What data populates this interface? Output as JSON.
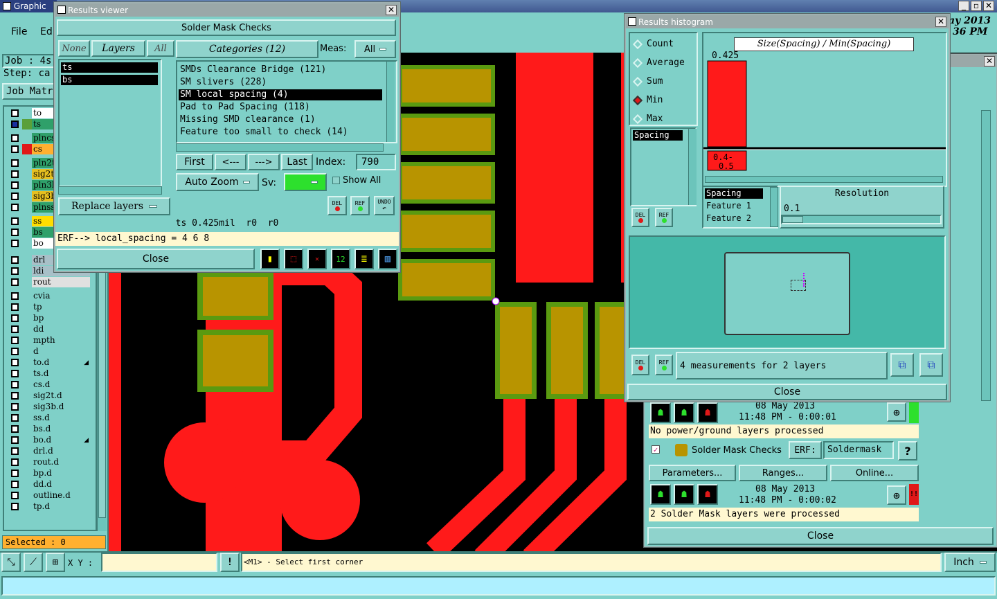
{
  "main_window": {
    "title": "Graphic Ed",
    "menu": [
      "File",
      "Edi"
    ],
    "job_label": "Job : 4s",
    "step_label": "Step: ca",
    "job_matrix_button": "Job Matr",
    "date_fragment": "ay 2013",
    "time_fragment": "36 PM"
  },
  "layers": [
    {
      "name": "to",
      "color": "#ffffff"
    },
    {
      "name": "ts",
      "color": "#2fa06a",
      "swatch": "#5aa03a",
      "active": true
    },
    {
      "name": "plncs",
      "color": "#2fa06a"
    },
    {
      "name": "cs",
      "color": "#ffb030",
      "swatch": "#e01818"
    },
    {
      "name": "pln2t",
      "color": "#2fa06a"
    },
    {
      "name": "sig2t",
      "color": "#e6c020"
    },
    {
      "name": "pln3b",
      "color": "#2fa06a"
    },
    {
      "name": "sig3b",
      "color": "#e6c020"
    },
    {
      "name": "plnss",
      "color": "#2fa06a"
    },
    {
      "name": "ss",
      "color": "#ffdd00"
    },
    {
      "name": "bs",
      "color": "#2fa06a"
    },
    {
      "name": "bo",
      "color": "#ffffff"
    },
    {
      "name": "drl",
      "color": "#a8c0c8"
    },
    {
      "name": "ldi",
      "color": "#a8c0c8"
    },
    {
      "name": "rout",
      "color": "#e0e0e0"
    },
    {
      "name": "cvia",
      "color": "#7fd0c8"
    },
    {
      "name": "tp",
      "color": "#7fd0c8"
    },
    {
      "name": "bp",
      "color": "#7fd0c8"
    },
    {
      "name": "dd",
      "color": "#7fd0c8"
    },
    {
      "name": "mpth",
      "color": "#7fd0c8"
    },
    {
      "name": "d",
      "color": "#7fd0c8"
    },
    {
      "name": "to.d",
      "color": "#7fd0c8",
      "flag": true
    },
    {
      "name": "ts.d",
      "color": "#7fd0c8"
    },
    {
      "name": "cs.d",
      "color": "#7fd0c8"
    },
    {
      "name": "sig2t.d",
      "color": "#7fd0c8"
    },
    {
      "name": "sig3b.d",
      "color": "#7fd0c8"
    },
    {
      "name": "ss.d",
      "color": "#7fd0c8"
    },
    {
      "name": "bs.d",
      "color": "#7fd0c8"
    },
    {
      "name": "bo.d",
      "color": "#7fd0c8",
      "flag": true
    },
    {
      "name": "drl.d",
      "color": "#7fd0c8"
    },
    {
      "name": "rout.d",
      "color": "#7fd0c8"
    },
    {
      "name": "bp.d",
      "color": "#7fd0c8"
    },
    {
      "name": "dd.d",
      "color": "#7fd0c8"
    },
    {
      "name": "outline.d",
      "color": "#7fd0c8"
    },
    {
      "name": "tp.d",
      "color": "#7fd0c8"
    }
  ],
  "selected_label": "Selected : 0",
  "bottom_bar": {
    "xy_label": "X Y :",
    "xy_value": "",
    "hint": "<M1> - Select first corner",
    "units": "Inch"
  },
  "results_viewer": {
    "title": "Results viewer",
    "header": "Solder Mask Checks",
    "none_btn": "None",
    "layers_btn": "Layers",
    "all_btn": "All",
    "layer_items": [
      "ts",
      "bs"
    ],
    "categories_btn": "Categories (12)",
    "meas_label": "Meas:",
    "meas_value": "All",
    "categories": [
      {
        "label": "SMDs Clearance Bridge (121)",
        "selected": false
      },
      {
        "label": "SM slivers (228)",
        "selected": false
      },
      {
        "label": "SM local spacing (4)",
        "selected": true
      },
      {
        "label": "Pad to Pad Spacing (118)",
        "selected": false
      },
      {
        "label": "Missing SMD clearance (1)",
        "selected": false
      },
      {
        "label": "Feature too small to check (14)",
        "selected": false
      }
    ],
    "first_btn": "First",
    "prev_btn": "<---",
    "next_btn": "--->",
    "last_btn": "Last",
    "index_label": "Index:",
    "index_value": "790",
    "auto_zoom": "Auto Zoom",
    "sv_label": "Sv:",
    "show_all": "Show All",
    "replace_layers": "Replace layers",
    "del_btn": "DEL",
    "ref_btn": "REF",
    "undo_btn": "UNDO",
    "status_line": "ts 0.425mil  r0  r0",
    "erf_line": "ERF--> local_spacing = 4 6 8",
    "close_btn": "Close"
  },
  "histogram": {
    "title": "Results histogram",
    "options": [
      {
        "label": "Count",
        "selected": false
      },
      {
        "label": "Average",
        "selected": false
      },
      {
        "label": "Sum",
        "selected": false
      },
      {
        "label": "Min",
        "selected": true
      },
      {
        "label": "Max",
        "selected": false
      }
    ],
    "spacing_list_item": "Spacing",
    "chart_title": "Size(Spacing) / Min(Spacing)",
    "bar_value_label": "0.425",
    "bin_label": "0.4-\n0.5",
    "list2": [
      "Spacing",
      "Feature 1",
      "Feature 2"
    ],
    "resolution_label": "Resolution",
    "resolution_value": "0.1",
    "measurements": "4 measurements for 2 layers",
    "close_btn": "Close",
    "del_btn": "DEL",
    "ref_btn": "REF"
  },
  "analysis_panel": {
    "date1": "08 May 2013",
    "time1": "11:48 PM - 0:00:01",
    "msg1": "No power/ground layers processed",
    "action_title": "Solder Mask Checks",
    "erf_label": "ERF:",
    "erf_value": "Soldermask",
    "help_btn": "?",
    "params_btn": "Parameters...",
    "ranges_btn": "Ranges...",
    "online_btn": "Online...",
    "date2": "08 May 2013",
    "time2": "11:48 PM - 0:00:02",
    "msg2": "2 Solder Mask layers were processed",
    "close_btn": "Close",
    "alert": "!!"
  },
  "chart_data": {
    "type": "bar",
    "title": "Size(Spacing) / Min(Spacing)",
    "categories": [
      "0.4-0.5"
    ],
    "values": [
      0.425
    ],
    "xlabel": "",
    "ylabel": ""
  },
  "colors": {
    "panel": "#7fd0c8",
    "copper": "#ff1a1a",
    "pad_gold": "#b89400",
    "mask_green": "#5a9a10",
    "title_bar": "#9aa8a8",
    "selection": "#000000"
  }
}
